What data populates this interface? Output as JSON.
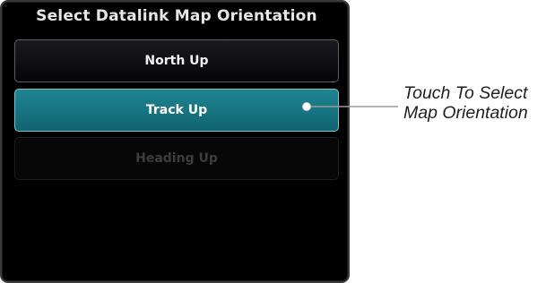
{
  "dialog": {
    "title": "Select Datalink Map Orientation",
    "options": [
      {
        "label": "North Up",
        "state": "normal"
      },
      {
        "label": "Track Up",
        "state": "selected"
      },
      {
        "label": "Heading Up",
        "state": "disabled"
      }
    ]
  },
  "callout": {
    "line1": "Touch To Select",
    "line2": "Map Orientation"
  },
  "colors": {
    "selected": "#1b7d8a",
    "panel_bg": "#000000"
  }
}
